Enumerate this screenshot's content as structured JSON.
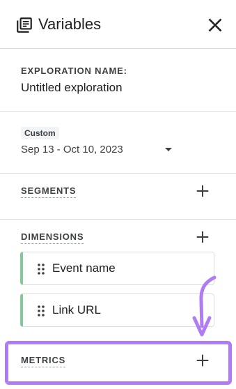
{
  "header": {
    "icon": "variables-list-icon",
    "title": "Variables",
    "close_icon": "close-icon"
  },
  "exploration": {
    "label": "EXPLORATION NAME:",
    "value": "Untitled exploration"
  },
  "date_range": {
    "badge": "Custom",
    "value": "Sep 13 - Oct 10, 2023",
    "dropdown_icon": "caret-down-icon"
  },
  "segments": {
    "label": "SEGMENTS",
    "add_icon": "plus-icon"
  },
  "dimensions": {
    "label": "DIMENSIONS",
    "add_icon": "plus-icon",
    "items": [
      {
        "label": "Event name",
        "handle_icon": "drag-handle-icon"
      },
      {
        "label": "Link URL",
        "handle_icon": "drag-handle-icon"
      }
    ],
    "accent_color": "#81c995"
  },
  "metrics": {
    "label": "METRICS",
    "add_icon": "plus-icon",
    "highlight_color": "#b07cf4"
  }
}
